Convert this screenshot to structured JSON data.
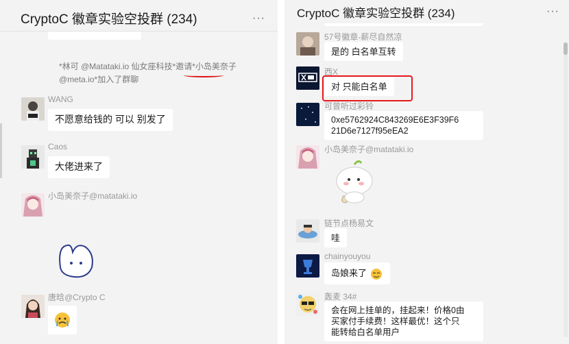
{
  "left": {
    "title": "CryptoC 徽章实验空投群 (234)",
    "more": "···",
    "system_line1_a": "*林可 @Matataki.io 仙女座科技*邀请*",
    "system_line1_b": "小岛美奈子",
    "system_line2": "@meta.io*加入了群聊",
    "messages": [
      {
        "name": "WANG",
        "text": "不愿意给钱的 可以 别发了"
      },
      {
        "name": "Caos",
        "text": "大佬进来了"
      },
      {
        "name": "小岛美奈子@matataki.io",
        "text": ""
      },
      {
        "name": "唐晗@Crypto C",
        "text": ""
      }
    ]
  },
  "right": {
    "title": "CryptoC 徽章实验空投群 (234)",
    "more": "···",
    "messages": [
      {
        "name": "57号徽章-薪尽自然凉",
        "text": "是的 白名单互转"
      },
      {
        "name": "西X",
        "text": "对 只能白名单"
      },
      {
        "name": "可曾听过彩铃",
        "text_line1": "0xe5762924C843269E6E3F39F6",
        "text_line2": "21D6e7127f95eEA2"
      },
      {
        "name": "小岛美奈子@matataki.io",
        "text": ""
      },
      {
        "name": "链节点杨易文",
        "text": "哇"
      },
      {
        "name": "chainyouyou",
        "text": "岛娘来了"
      },
      {
        "name": "轰麦 34#",
        "text_line1": "会在网上挂单的，挂起来！价格0由",
        "text_line2": "买家付手续费！这样最优！这个只",
        "text_line3": "能转给白名单用户"
      }
    ]
  },
  "colors": {
    "highlight_box": "#e8171b",
    "background": "#f3f3f3",
    "bubble": "#ffffff"
  }
}
